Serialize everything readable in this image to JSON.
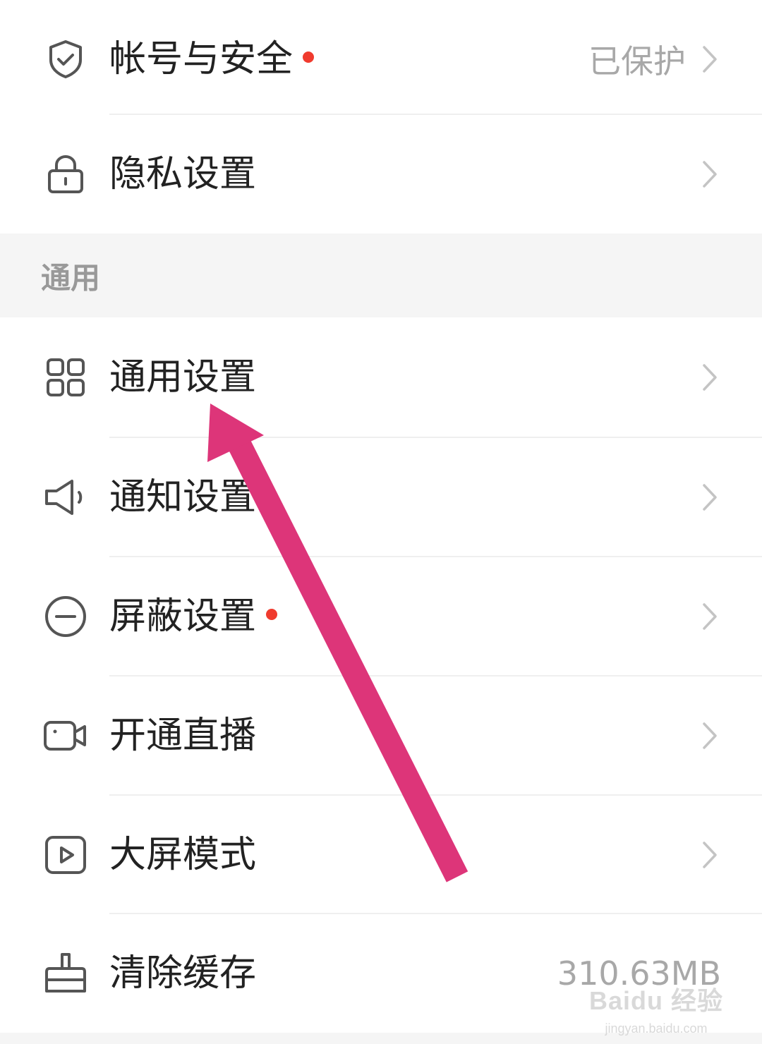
{
  "account_section": {
    "items": [
      {
        "label": "帐号与安全",
        "icon": "shield-check-icon",
        "value": "已保护",
        "has_dot": true
      },
      {
        "label": "隐私设置",
        "icon": "lock-icon"
      }
    ]
  },
  "general_section": {
    "title": "通用",
    "items": [
      {
        "label": "通用设置",
        "icon": "grid-icon"
      },
      {
        "label": "通知设置",
        "icon": "speaker-icon"
      },
      {
        "label": "屏蔽设置",
        "icon": "minus-circle-icon",
        "has_dot": true
      },
      {
        "label": "开通直播",
        "icon": "video-camera-icon"
      },
      {
        "label": "大屏模式",
        "icon": "play-screen-icon"
      },
      {
        "label": "清除缓存",
        "icon": "broom-icon",
        "value": "310.63MB"
      }
    ]
  },
  "watermark": {
    "text": "Baidu 经验",
    "url": "jingyan.baidu.com"
  },
  "colors": {
    "text_primary": "#222222",
    "text_secondary": "#a8a8a8",
    "section_bg": "#f5f5f5",
    "red_dot": "#f03b2e",
    "annotation_arrow": "#dd3579",
    "icon_stroke": "#555555"
  }
}
